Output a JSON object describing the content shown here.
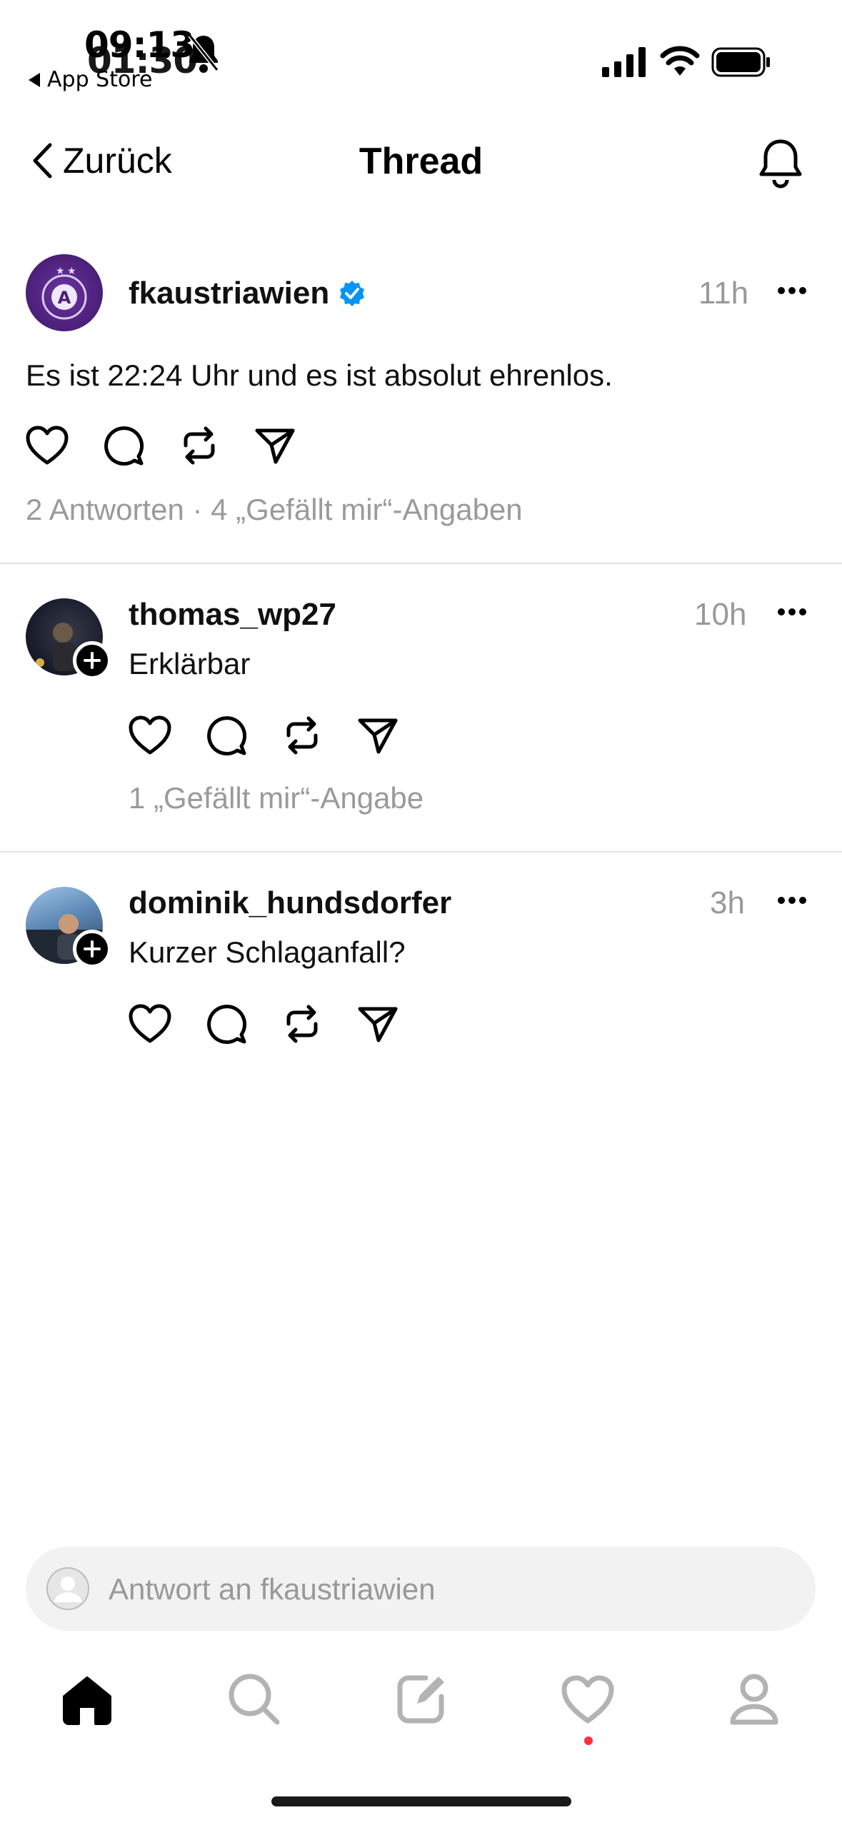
{
  "status_bar": {
    "time": "09:13",
    "time_overlay": "01:30",
    "back_app_label": "App Store"
  },
  "header": {
    "back_label": "Zurück",
    "title": "Thread"
  },
  "main_post": {
    "username": "fkaustriawien",
    "verified": true,
    "time": "11h",
    "text": "Es ist 22:24 Uhr und es ist absolut ehrenlos.",
    "stats": "2 Antworten · 4 „Gefällt mir“-Angaben"
  },
  "replies": [
    {
      "username": "thomas_wp27",
      "time": "10h",
      "text": "Erklärbar",
      "stats": "1 „Gefällt mir“-Angabe"
    },
    {
      "username": "dominik_hundsdorfer",
      "time": "3h",
      "text": "Kurzer Schlaganfall?",
      "stats": ""
    }
  ],
  "reply_input": {
    "placeholder": "Antwort an fkaustriawien"
  },
  "bottom_nav": {
    "items": [
      "home-icon",
      "search-icon",
      "compose-icon",
      "activity-heart-icon",
      "profile-icon"
    ],
    "active": "home-icon",
    "notification_dot_color": "#ff3040"
  },
  "colors": {
    "verified": "#0095f6",
    "accent_brand": "#5b2a86"
  }
}
